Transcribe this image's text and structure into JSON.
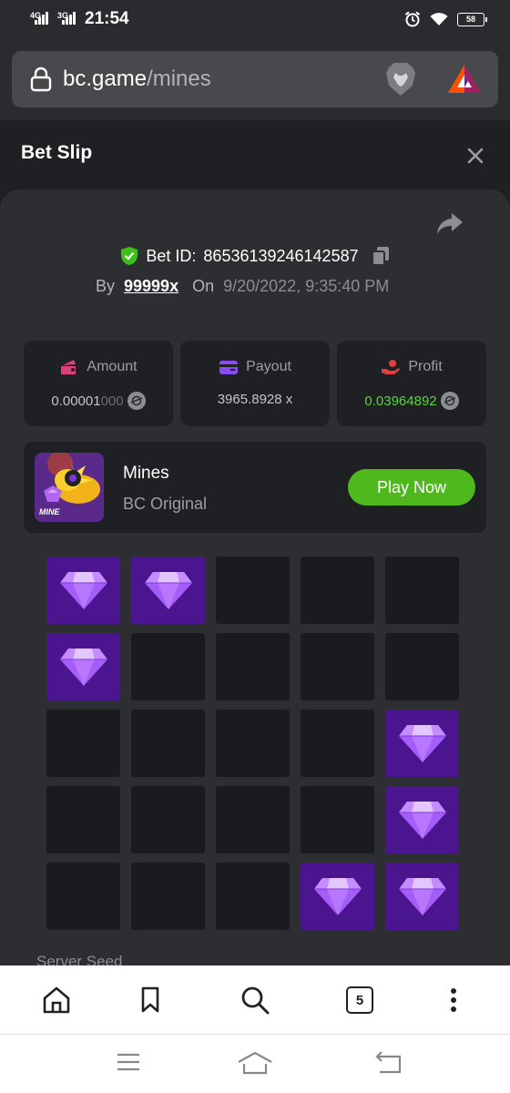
{
  "status_bar": {
    "net1": "4G",
    "net2": "3G",
    "time": "21:54",
    "battery": "58"
  },
  "browser": {
    "url_domain": "bc.game",
    "url_path": "/mines",
    "tab_count": "5"
  },
  "slip": {
    "title": "Bet Slip",
    "bet_id_label": "Bet ID:",
    "bet_id": "86536139246142587",
    "by_label": "By",
    "user": "99999x",
    "on_label": "On",
    "date": "9/20/2022, 9:35:40 PM",
    "server_seed_label": "Server Seed"
  },
  "stats": {
    "amount": {
      "label": "Amount",
      "value_main": "0.00001",
      "value_dim": "000"
    },
    "payout": {
      "label": "Payout",
      "value": "3965.8928 x"
    },
    "profit": {
      "label": "Profit",
      "value": "0.03964892"
    }
  },
  "game": {
    "name": "Mines",
    "subtitle": "BC Original",
    "play_label": "Play Now",
    "thumb_text": "MINE"
  },
  "grid": [
    [
      1,
      1,
      0,
      0,
      0
    ],
    [
      1,
      0,
      0,
      0,
      0
    ],
    [
      0,
      0,
      0,
      0,
      1
    ],
    [
      0,
      0,
      0,
      0,
      1
    ],
    [
      0,
      0,
      0,
      1,
      1
    ]
  ],
  "colors": {
    "accent_green": "#4fb81c",
    "profit_green": "#5bd43a",
    "gem_tile": "#4b1590",
    "card_bg": "#2d2e31"
  }
}
